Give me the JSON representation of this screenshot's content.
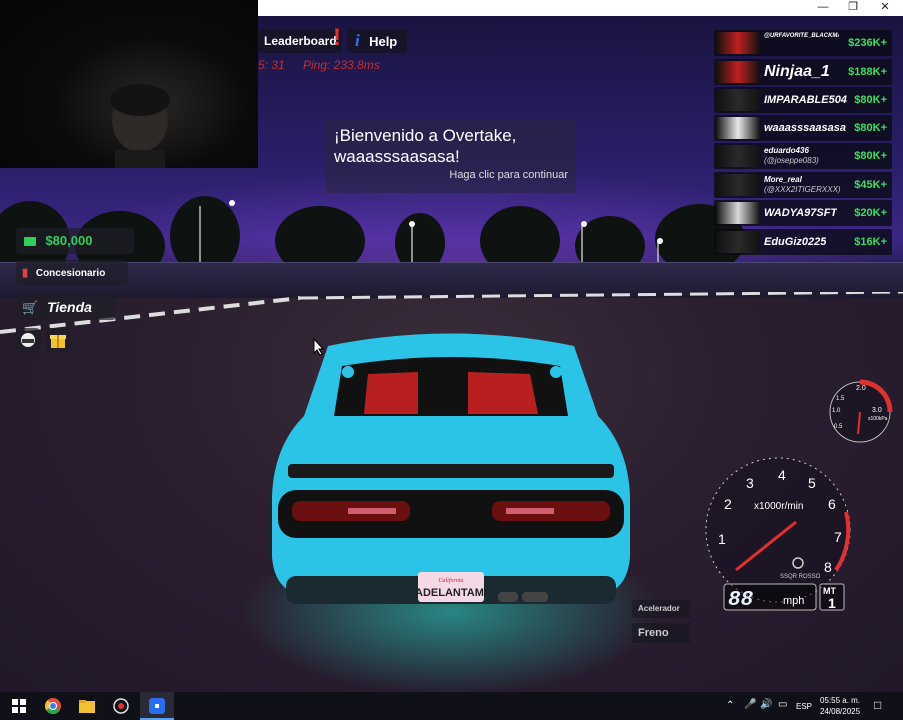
{
  "window": {
    "minimize": "—",
    "maximize": "❐",
    "close": "✕"
  },
  "top_bar": {
    "leaderboard_label": "Leaderboard",
    "alert_mark": "!",
    "help_label": "Help",
    "help_icon": "i",
    "stat_left": "5: 31",
    "ping": "Ping: 233.8ms"
  },
  "welcome": {
    "title_line1": "¡Bienvenido a Overtake,",
    "title_line2": "waaasssaasasa!",
    "subtitle": "Haga clic para continuar"
  },
  "left_menu": {
    "money": "$80,000",
    "dealership": "Concesionario",
    "store": "Tienda"
  },
  "leaderboard": [
    {
      "name": "@URFAVORITE_BLACKMAN",
      "money": "$236K+",
      "small": true
    },
    {
      "name": "Ninjaa_1",
      "money": "$188K+",
      "small": false,
      "big": true
    },
    {
      "name": "IMPARABLE504",
      "money": "$80K+",
      "small": false
    },
    {
      "name": "waaasssaasasa",
      "money": "$80K+",
      "small": false
    },
    {
      "name": "eduardo436",
      "sub": "(@joseppe083)",
      "money": "$80K+",
      "small": true
    },
    {
      "name": "More_real",
      "sub": "(@XXX2ITIGERXXX)",
      "money": "$45K+",
      "small": true
    },
    {
      "name": "WADYA97SFT",
      "money": "$20K+",
      "small": false
    },
    {
      "name": "EduGiz0225",
      "money": "$16K+",
      "small": false
    }
  ],
  "car": {
    "license_plate": "ADELANTAMI",
    "plate_state": "California"
  },
  "boost_gauge": {
    "labels": [
      "2.0",
      "1.5",
      "3.0",
      "1.0",
      "0.5",
      "x100kPa"
    ]
  },
  "tachometer": {
    "numbers": [
      "1",
      "2",
      "3",
      "4",
      "5",
      "6",
      "7",
      "8"
    ],
    "unit": "x1000r/min",
    "brand": "SSQR ROSSO",
    "speed": "88",
    "speed_unit": "mph",
    "gear_label": "MT",
    "gear": "1"
  },
  "pedals": {
    "throttle": "Acelerador",
    "brake": "Freno"
  },
  "taskbar": {
    "language": "ESP",
    "time": "05:55 a. m.",
    "date": "24/08/2025"
  },
  "colors": {
    "accent_green": "#38e05a",
    "car_cyan": "#2cc4e6",
    "alert_red": "#e03030"
  }
}
